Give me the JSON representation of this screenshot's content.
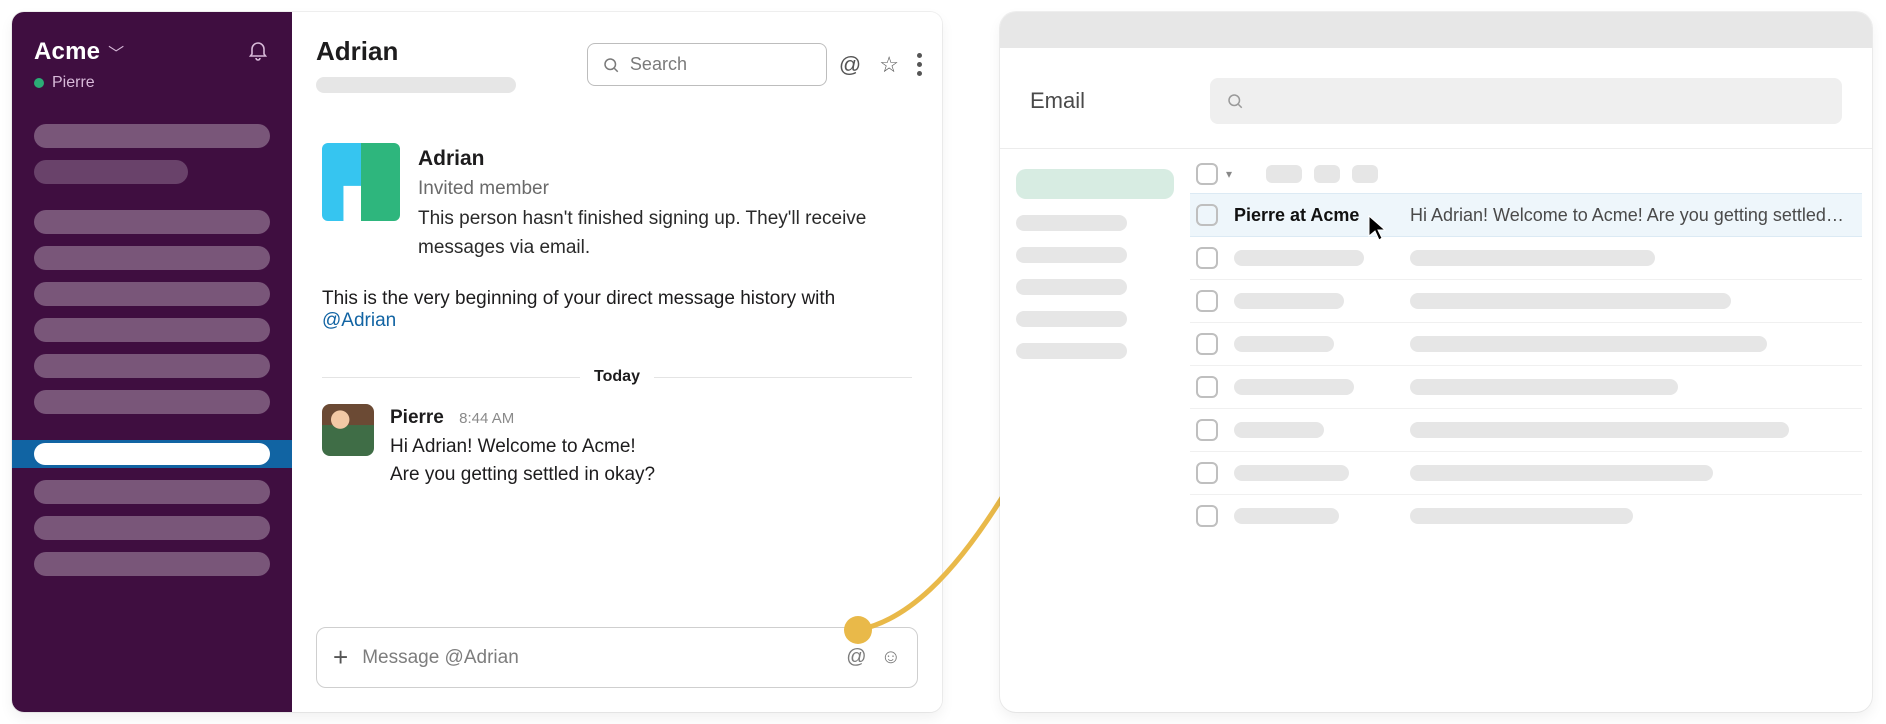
{
  "slack": {
    "workspace": {
      "name": "Acme"
    },
    "current_user": "Pierre",
    "channel_title": "Adrian",
    "search_placeholder": "Search",
    "intro": {
      "name": "Adrian",
      "role": "Invited member",
      "description": "This person hasn't finished signing up. They'll receive messages via email."
    },
    "beginning_prefix": "This is the very beginning of your direct message history with ",
    "beginning_mention": "@Adrian",
    "divider_label": "Today",
    "message": {
      "author": "Pierre",
      "timestamp": "8:44 AM",
      "body_line1": "Hi Adrian! Welcome to Acme!",
      "body_line2": "Are you getting settled in okay?"
    },
    "composer_placeholder": "Message @Adrian"
  },
  "email": {
    "title": "Email",
    "highlight_row": {
      "sender": "Pierre at Acme",
      "subject": "Hi Adrian! Welcome to Acme! Are you getting settled…"
    }
  },
  "colors": {
    "slack_sidebar": "#3f0e40",
    "slack_selection": "#1164a3",
    "arrow": "#e9b949",
    "email_side_selected": "#d7ece2",
    "email_row_highlight": "#eef6fb",
    "mention": "#1264a3"
  }
}
